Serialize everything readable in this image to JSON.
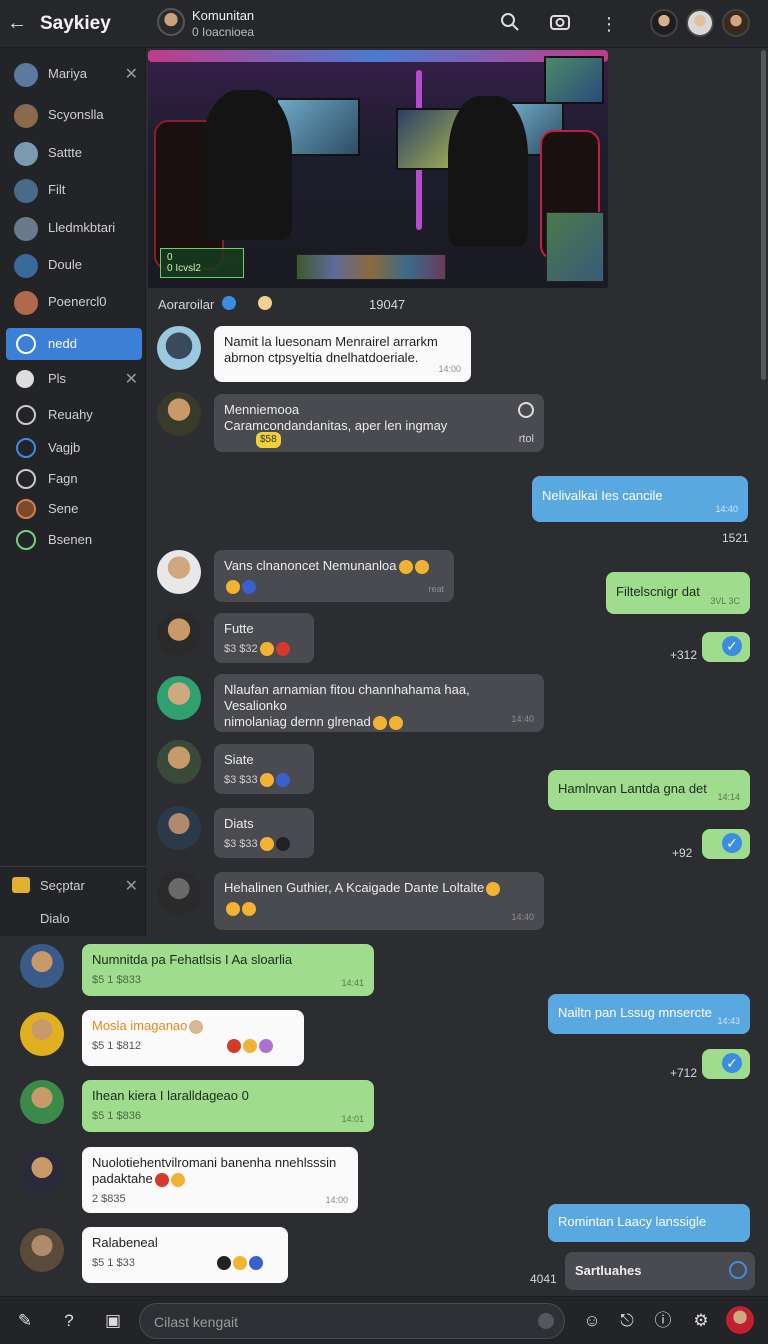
{
  "topbar": {
    "title": "Saykiey",
    "channel_name": "Komunitan",
    "channel_sub": "0 Ioacnioea"
  },
  "sidebar": {
    "items": [
      {
        "label": "Mariya"
      },
      {
        "label": "Scyonslla"
      },
      {
        "label": "Sattte"
      },
      {
        "label": "Filt"
      },
      {
        "label": "Lledmkbtari"
      },
      {
        "label": "Doule"
      },
      {
        "label": "Poenercl0"
      },
      {
        "label": "nedd"
      },
      {
        "label": "Pls"
      },
      {
        "label": "Reuahy"
      },
      {
        "label": "Vagjb"
      },
      {
        "label": "Fagn"
      },
      {
        "label": "Sene"
      },
      {
        "label": "Bsenen"
      }
    ],
    "bottom_items": [
      {
        "label": "Seçptar"
      },
      {
        "label": "Dialo"
      }
    ]
  },
  "media_caption": {
    "author": "Aoraroilar",
    "time": "19047",
    "hud_line1": "0",
    "hud_line2": "0 Icvsl2"
  },
  "messages": [
    {
      "text": "Namit la luesonam Menrairel arrarkm",
      "text2": "abrnon ctpsyeltia dnelhatdoeriale.",
      "meta": "14:00"
    },
    {
      "text": "Menniemooa",
      "text2": "Caramcondandanitas, aper len ingmay",
      "meta": "rtol",
      "tag": "$58"
    },
    {
      "text": "Nelivalkai Ies cancile",
      "meta": "14:40"
    },
    {
      "text": "Vans clnanoncet Nemunanloa",
      "meta": "reat"
    },
    {
      "text": "Filtelscnigr dat",
      "meta": "3VL 3C"
    },
    {
      "text": "Futte",
      "sub": "$3 $32"
    },
    {
      "text": "Nlaufan arnamian fitou channhahama haa, Vesalionko",
      "text2": "nimolaniag dernn glrenad",
      "meta": "14:40"
    },
    {
      "text": "Siate",
      "sub": "$3 $33"
    },
    {
      "text": "Hamlnvan Lantda gna det",
      "meta": "14:14"
    },
    {
      "text": "Diats",
      "sub": "$3 $33"
    },
    {
      "text": "Hehalinen Guthier, A Kcaigade  Dante Loltalte",
      "meta": "14:40"
    },
    {
      "text": "Numnitda pa Fehatlsis I Aa sloarlia",
      "sub": "$5 1 $833",
      "meta": "14:41"
    },
    {
      "text": "Nailtn pan Lssug mnsercte",
      "meta": "14:43"
    },
    {
      "text": "Mosla imaganao",
      "sub": "$5 1 $812"
    },
    {
      "text": "Ihean kiera I laralldageao 0",
      "sub": "$5 1 $836",
      "meta": "14:01"
    },
    {
      "text": "Nuolotiehentvilromani banenha nnehlsssin",
      "text2": "padaktahe",
      "sub": "2 $835",
      "meta": "14:00"
    },
    {
      "text": "Romintan Laacy lanssigle",
      "meta": ""
    },
    {
      "text": "Ralabeneal",
      "sub": "$5 1 $33"
    },
    {
      "text": "Sartluahes"
    }
  ],
  "timestamps": {
    "t1": "1521",
    "t2": "+312",
    "t3": "+92",
    "t4": "+712",
    "t5": "4041"
  },
  "composer": {
    "placeholder": "Cilast kengait"
  },
  "colors": {
    "accent": "#3b7fd6",
    "bubble_green": "#9fdc8e",
    "bubble_blue": "#5aa8e0",
    "bubble_dark": "#4a4b50"
  }
}
